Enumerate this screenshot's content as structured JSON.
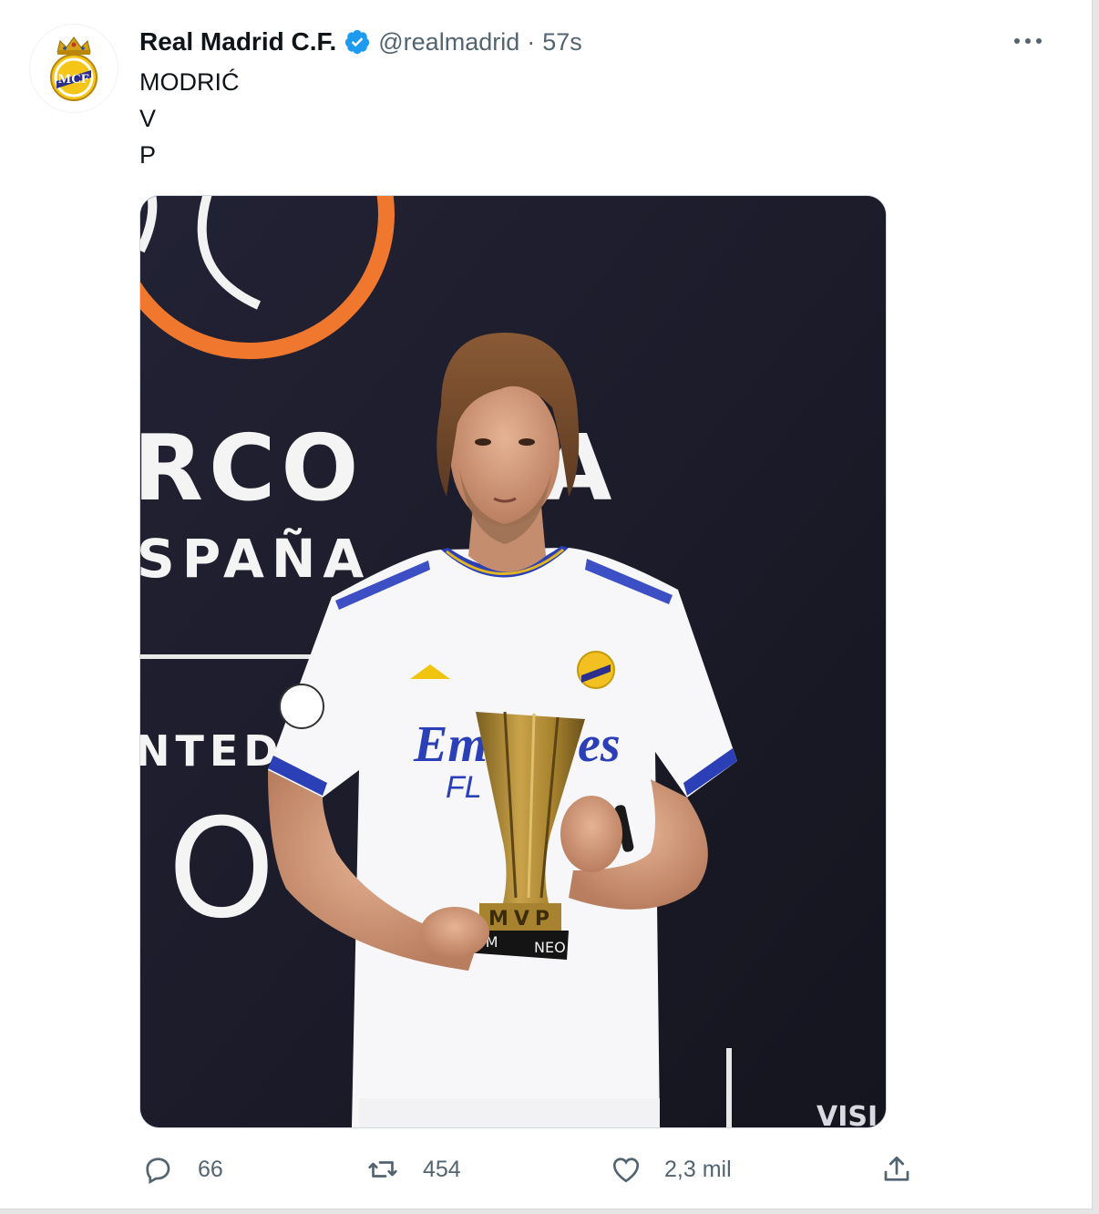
{
  "tweet": {
    "author": {
      "name": "Real Madrid C.F.",
      "handle": "@realmadrid",
      "verified": true,
      "avatar_icon": "real-madrid-crest"
    },
    "separator": "·",
    "timestamp": "57s",
    "text_lines": [
      "MODRIĆ",
      "V",
      "P"
    ],
    "media": {
      "kind": "photo",
      "visible_text": {
        "backdrop_fragment_1": "RCO",
        "backdrop_fragment_1b": "A",
        "backdrop_fragment_2": "SPAÑA",
        "backdrop_fragment_3": "NTED",
        "backdrop_fragment_4": "O",
        "shirt_sponsor": "Em",
        "shirt_sponsor_tail": "es",
        "shirt_sponsor_sub": "FL",
        "trophy_plaque": "MVP",
        "trophy_base_left": "EOM",
        "trophy_base_right": "NEO",
        "corner_text": "VISI"
      }
    },
    "actions": {
      "reply": {
        "icon": "reply-icon",
        "count": "66"
      },
      "retweet": {
        "icon": "retweet-icon",
        "count": "454"
      },
      "like": {
        "icon": "heart-icon",
        "count": "2,3 mil"
      },
      "share": {
        "icon": "share-icon"
      }
    },
    "more_icon": "more-icon"
  },
  "colors": {
    "verified_blue": "#1d9bf0",
    "text_primary": "#0f1419",
    "text_secondary": "#536471",
    "backdrop_navy": "#1d1d2e",
    "backdrop_orange": "#f0782e"
  }
}
